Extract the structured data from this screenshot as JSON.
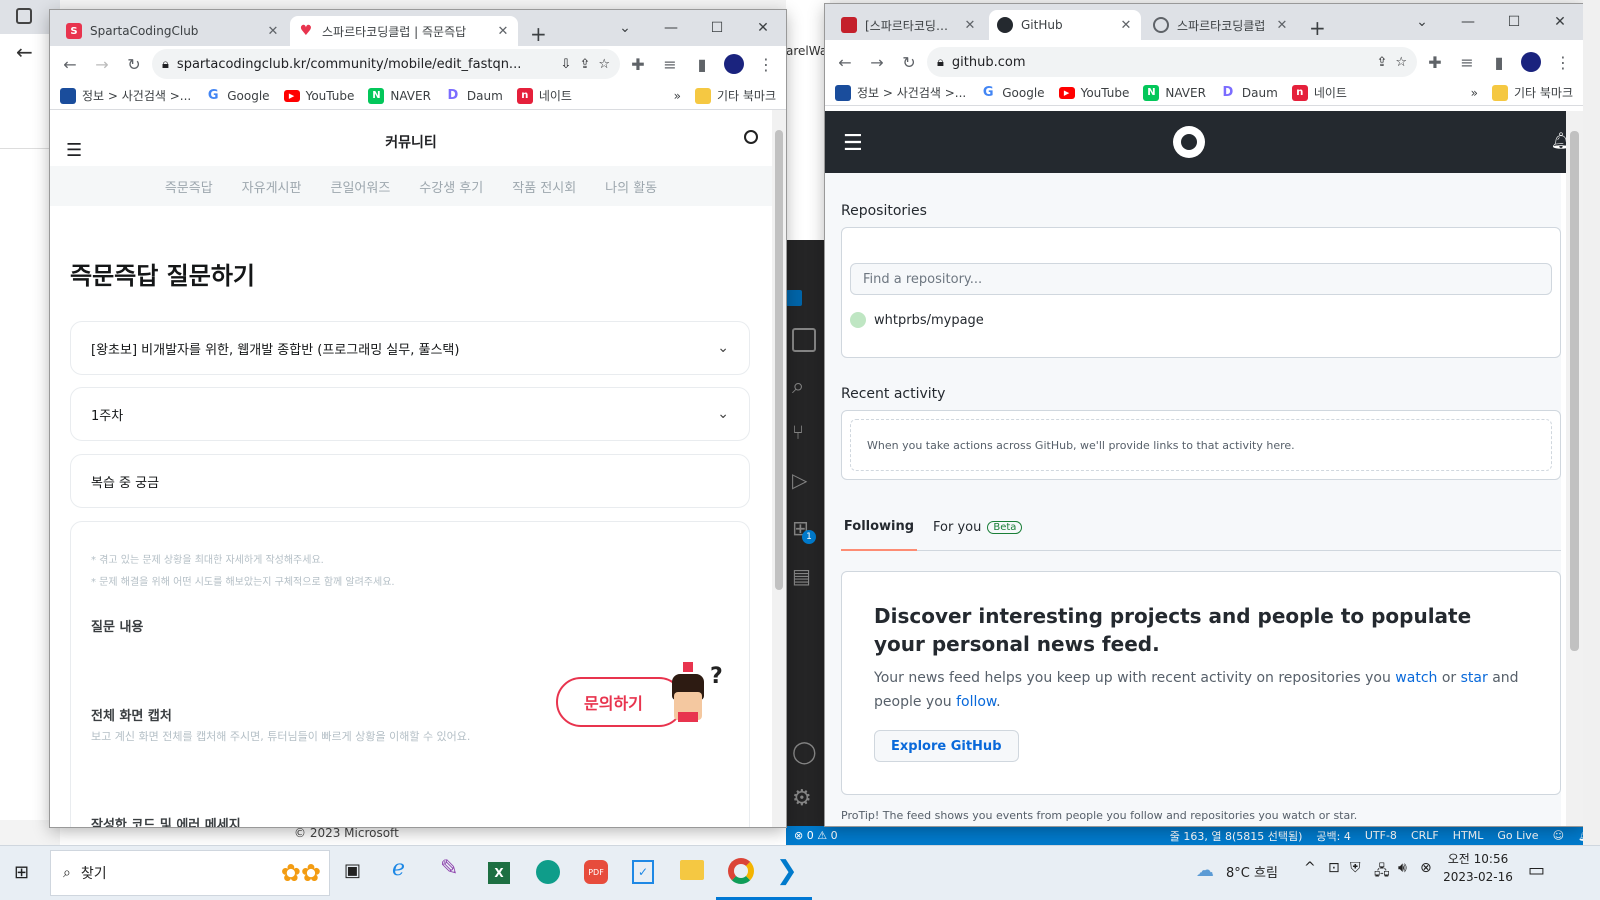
{
  "left_window": {
    "tabs": [
      {
        "title": "SpartaCodingClub",
        "active": false
      },
      {
        "title": "스파르타코딩클럽 | 즉문즉답",
        "active": true
      }
    ],
    "new_tab": "+",
    "url": "spartacodingclub.kr/community/mobile/edit_fastqn...",
    "bookmarks": [
      "정보 > 사건검색 >...",
      "Google",
      "YouTube",
      "NAVER",
      "Daum",
      "네이트"
    ],
    "bookmarks_more": "»",
    "bookmarks_other": "기타 북마크",
    "page": {
      "header_title": "커뮤니티",
      "nav": [
        "즉문즉답",
        "자유게시판",
        "큰일어워즈",
        "수강생 후기",
        "작품 전시회",
        "나의 활동"
      ],
      "heading": "즉문즉답 질문하기",
      "select_course": "[왕초보] 비개발자를 위한, 웹개발 종합반 (프로그래밍 실무, 풀스택)",
      "select_week": "1주차",
      "title_input": "복습 중 궁금",
      "hints": [
        "* 겪고 있는 문제 상황을 최대한 자세하게 작성해주세요.",
        "* 문제 해결을 위해 어떤 시도를 해보았는지 구체적으로 함께 알려주세요."
      ],
      "question_label": "질문 내용",
      "capture_label": "전체 화면 캡처",
      "capture_hint": "보고 계신 화면 전체를 캡처해 주시면, 튜터님들이 빠르게 상황을 이해할 수 있어요.",
      "code_label": "작성한 코드 및 에러 메세지",
      "inquiry_button": "문의하기",
      "mascot_mark": "?"
    }
  },
  "right_window": {
    "tabs": [
      {
        "title": "[스파르타코딩클럽",
        "active": false
      },
      {
        "title": "GitHub",
        "active": true
      },
      {
        "title": "스파르타코딩클럽",
        "active": false
      }
    ],
    "new_tab": "+",
    "url": "github.com",
    "bookmarks": [
      "정보 > 사건검색 >...",
      "Google",
      "YouTube",
      "NAVER",
      "Daum",
      "네이트"
    ],
    "bookmarks_more": "»",
    "bookmarks_other": "기타 북마크",
    "page": {
      "repositories_title": "Repositories",
      "find_placeholder": "Find a repository...",
      "repo": "whtprbs/mypage",
      "recent_title": "Recent activity",
      "recent_empty": "When you take actions across GitHub, we'll provide links to that activity here.",
      "tab_following": "Following",
      "tab_foryou": "For you",
      "beta": "Beta",
      "discover_title": "Discover interesting projects and people to populate your personal news feed.",
      "discover_text_1": "Your news feed helps you keep up with recent activity on repositories you",
      "link_watch": "watch",
      "or": "or",
      "link_star": "star",
      "discover_text_2": "and people you",
      "link_follow": "follow",
      "period": ".",
      "explore_button": "Explore GitHub",
      "protip": "ProTip! The feed shows you events from people you follow and repositories you watch or star."
    }
  },
  "background": {
    "vscode_fragment": "arelWa",
    "copyright": "© 2023 Microsoft",
    "vscode_status": {
      "problems": "⊗ 0 ⚠ 0",
      "position": "줄 163, 열 8(5815 선택됨)",
      "spaces": "공백: 4",
      "encoding": "UTF-8",
      "eol": "CRLF",
      "language": "HTML",
      "golive": "Go Live"
    },
    "extension_badge": "1"
  },
  "taskbar": {
    "search": "찾기",
    "weather": "8°C 흐림",
    "time": "오전 10:56",
    "date": "2023-02-16"
  },
  "colors": {
    "sparta_red": "#e8344e",
    "github_dark": "#24292f",
    "link_blue": "#0969da",
    "vscode_blue": "#007acc",
    "following_underline": "#fd8c73"
  }
}
